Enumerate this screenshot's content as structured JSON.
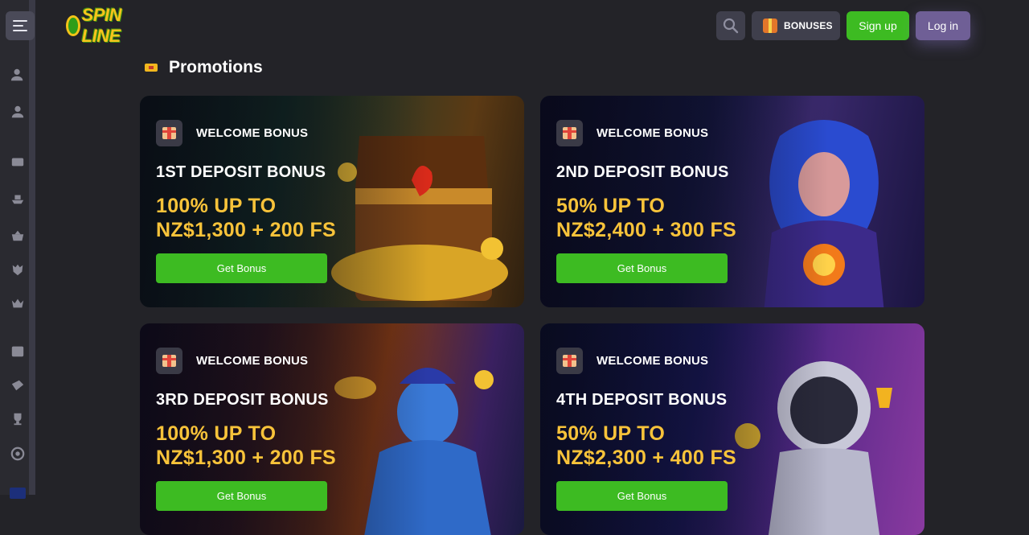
{
  "header": {
    "logo_text": "SPIN LINE",
    "bonuses_label": "BONUSES",
    "signup_label": "Sign up",
    "login_label": "Log in"
  },
  "sidebar": {
    "icons": [
      "user-add-icon",
      "user-icon",
      "slot-777-icon",
      "ship-icon",
      "basket-icon",
      "crown-shield-icon",
      "crown-icon",
      "calendar-icon",
      "ticket-icon",
      "trophy-icon",
      "target-icon"
    ],
    "flag": "new-zealand-flag-icon"
  },
  "page": {
    "title": "Promotions"
  },
  "promotions": [
    {
      "badge": "WELCOME BONUS",
      "title": "1ST DEPOSIT BONUS",
      "offer_line1": "100% UP TO",
      "offer_line2": "NZ$1,300 + 200 FS",
      "button": "Get Bonus"
    },
    {
      "badge": "WELCOME BONUS",
      "title": "2ND DEPOSIT BONUS",
      "offer_line1": "50% UP TO",
      "offer_line2": "NZ$2,400 + 300 FS",
      "button": "Get Bonus"
    },
    {
      "badge": "WELCOME BONUS",
      "title": "3RD DEPOSIT BONUS",
      "offer_line1": "100% UP TO",
      "offer_line2": "NZ$1,300 + 200 FS",
      "button": "Get Bonus"
    },
    {
      "badge": "WELCOME BONUS",
      "title": "4TH DEPOSIT BONUS",
      "offer_line1": "50% UP TO",
      "offer_line2": "NZ$2,300 + 400 FS",
      "button": "Get Bonus"
    }
  ],
  "colors": {
    "background": "#232328",
    "accent_green": "#3dbb22",
    "login_purple": "#6f5f96",
    "offer_gold": "#f8c33a"
  }
}
